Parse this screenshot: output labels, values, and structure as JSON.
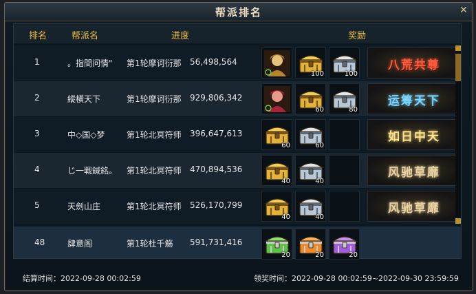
{
  "window": {
    "title": "帮派排名"
  },
  "headers": {
    "rank": "排名",
    "name": "帮派名",
    "progress": "进度",
    "reward": "奖励"
  },
  "rows": [
    {
      "rank": "1",
      "name": "。指間问情\"",
      "stage": "第1轮摩诃衍那",
      "score": "56,498,564",
      "items": [
        {
          "kind": "portrait-gold",
          "qty": ""
        },
        {
          "kind": "chest-gold",
          "qty": "100"
        },
        {
          "kind": "chest-silver",
          "qty": "100"
        }
      ],
      "title": "八荒共尊",
      "title_color": "#ff5a3a"
    },
    {
      "rank": "2",
      "name": "縱橫天下",
      "stage": "第1轮摩诃衍那",
      "score": "929,806,342",
      "items": [
        {
          "kind": "portrait-red",
          "qty": ""
        },
        {
          "kind": "chest-gold",
          "qty": "60"
        },
        {
          "kind": "chest-silver",
          "qty": "80"
        }
      ],
      "title": "运筹天下",
      "title_color": "#7ad6ff"
    },
    {
      "rank": "3",
      "name": "中◇国◇梦",
      "stage": "第1轮北冥符师",
      "score": "396,647,613",
      "items": [
        {
          "kind": "chest-gold",
          "qty": "60"
        },
        {
          "kind": "chest-silver",
          "qty": "60"
        },
        {
          "kind": "empty",
          "qty": ""
        }
      ],
      "title": "如日中天",
      "title_color": "#ffe38a"
    },
    {
      "rank": "4",
      "name": "じ一戦鍼銘。",
      "stage": "第1轮北冥符师",
      "score": "470,894,536",
      "items": [
        {
          "kind": "chest-gold",
          "qty": "40"
        },
        {
          "kind": "chest-silver",
          "qty": "40"
        },
        {
          "kind": "empty",
          "qty": ""
        }
      ],
      "title": "风驰草靡",
      "title_color": "#e8d2a0"
    },
    {
      "rank": "5",
      "name": "天劍山庄",
      "stage": "第1轮北冥符师",
      "score": "526,170,799",
      "items": [
        {
          "kind": "chest-gold",
          "qty": "40"
        },
        {
          "kind": "chest-silver",
          "qty": "40"
        },
        {
          "kind": "empty",
          "qty": ""
        }
      ],
      "title": "风驰草靡",
      "title_color": "#e8d2a0"
    }
  ],
  "my_guild": {
    "rank": "48",
    "name": "肆意阁",
    "stage": "第1轮杜千觞",
    "score": "591,731,416",
    "items": [
      {
        "kind": "chest-green",
        "qty": "20"
      },
      {
        "kind": "chest-orange",
        "qty": "20"
      },
      {
        "kind": "chest-purple",
        "qty": "20"
      }
    ]
  },
  "footer": {
    "settle": "结算时间：2022-09-28 00:02:59",
    "claim": "领奖时间：2022-09-28 00:02:59~2022-09-30 23:59:59"
  },
  "colors": {
    "header_text": "#f2c042",
    "gold": "#e2b23a",
    "silver": "#b9c6d4",
    "green": "#5ec24a",
    "orange": "#f08a2a",
    "purple": "#a35ce0"
  }
}
